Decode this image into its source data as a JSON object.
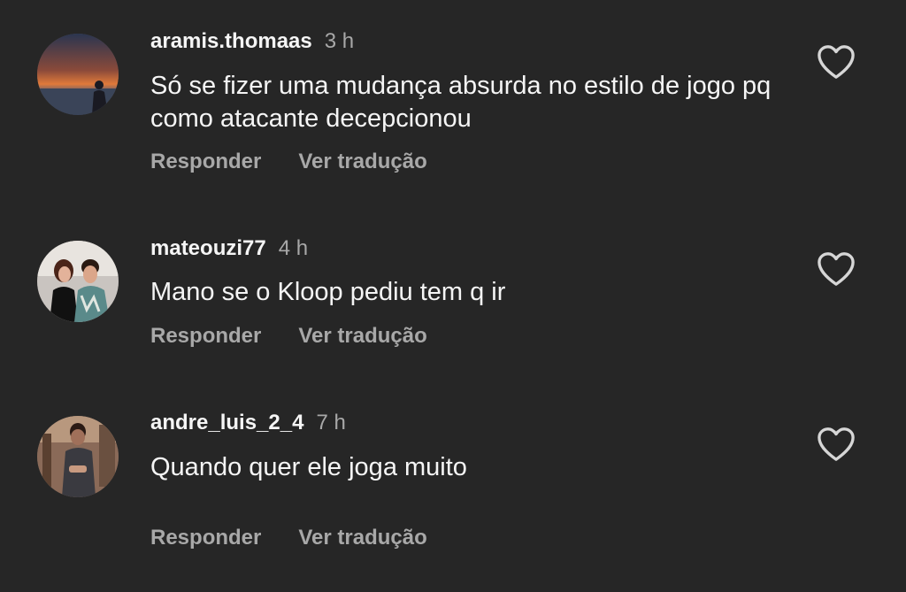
{
  "comments": [
    {
      "username": "aramis.thomaas",
      "time": "3 h",
      "text": "Só se fizer uma mudança absurda no estilo de jogo pq como atacante decepcionou",
      "reply_label": "Responder",
      "translate_label": "Ver tradução"
    },
    {
      "username": "mateouzi77",
      "time": "4 h",
      "text": "Mano se o Kloop pediu tem q ir",
      "reply_label": "Responder",
      "translate_label": "Ver tradução"
    },
    {
      "username": "andre_luis_2_4",
      "time": "7 h",
      "text": "Quando quer ele joga muito",
      "reply_label": "Responder",
      "translate_label": "Ver tradução"
    }
  ],
  "icons": {
    "like": "heart-outline-icon"
  },
  "colors": {
    "background": "#262626",
    "primary_text": "#f5f5f5",
    "secondary_text": "#a8a8a8"
  }
}
